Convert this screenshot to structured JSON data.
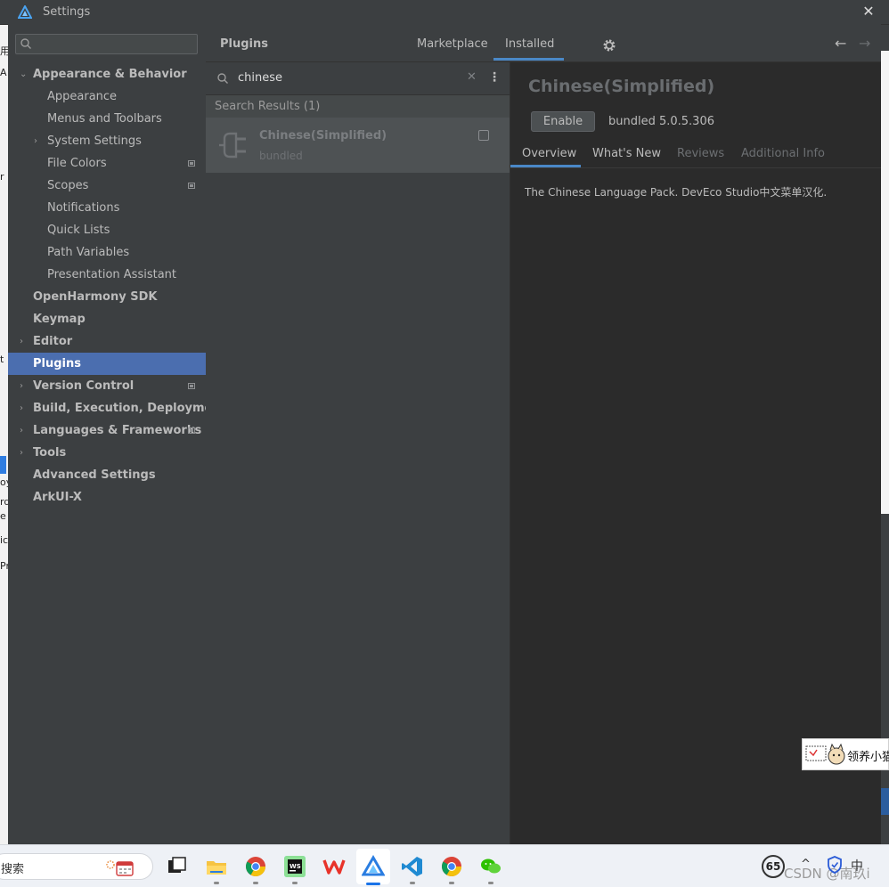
{
  "window": {
    "title": "Settings"
  },
  "sidebar": {
    "items": [
      {
        "label": "Appearance & Behavior",
        "arrow": "⌄"
      },
      {
        "label": "Appearance"
      },
      {
        "label": "Menus and Toolbars"
      },
      {
        "label": "System Settings",
        "arrow": "›"
      },
      {
        "label": "File Colors"
      },
      {
        "label": "Scopes"
      },
      {
        "label": "Notifications"
      },
      {
        "label": "Quick Lists"
      },
      {
        "label": "Path Variables"
      },
      {
        "label": "Presentation Assistant"
      },
      {
        "label": "OpenHarmony SDK"
      },
      {
        "label": "Keymap"
      },
      {
        "label": "Editor",
        "arrow": "›"
      },
      {
        "label": "Plugins"
      },
      {
        "label": "Version Control",
        "arrow": "›"
      },
      {
        "label": "Build, Execution, Deployment",
        "arrow": "›"
      },
      {
        "label": "Languages & Frameworks",
        "arrow": "›"
      },
      {
        "label": "Tools",
        "arrow": "›"
      },
      {
        "label": "Advanced Settings"
      },
      {
        "label": "ArkUI-X"
      }
    ]
  },
  "header": {
    "title": "Plugins",
    "tabs": [
      "Marketplace",
      "Installed"
    ],
    "nav": {
      "back": "←",
      "forward": "→"
    }
  },
  "plugin_list": {
    "search_value": "chinese",
    "clear_glyph": "✕",
    "more_glyph": "⋮",
    "results_label": "Search Results (1)",
    "items": [
      {
        "name": "Chinese(Simplified)",
        "status": "bundled"
      }
    ]
  },
  "detail": {
    "name": "Chinese(Simplified)",
    "enable_label": "Enable",
    "version": "bundled 5.0.5.306",
    "tabs": [
      "Overview",
      "What's New",
      "Reviews",
      "Additional Info"
    ],
    "description": "The Chinese Language Pack. DevEco Studio中文菜单汉化."
  },
  "background": {
    "left_glyphs": [
      "用",
      "A",
      "r",
      "t",
      "oy",
      "rd",
      "e",
      "ic",
      "Pr"
    ]
  },
  "popup": {
    "text": "领养小猫"
  },
  "taskbar": {
    "search_text": "搜索",
    "apps": [
      "windows-terminal",
      "file-explorer",
      "chrome",
      "webstorm",
      "wps",
      "deveco-studio",
      "vscode",
      "chrome",
      "wechat"
    ],
    "tray_badge": "65",
    "tray_chevron": "^",
    "ime": "中",
    "watermark": "CSDN @南玖i"
  },
  "colors": {
    "accent": "#4a88c7",
    "selection": "#4b6eaf",
    "panel": "#3c3f41",
    "content": "#2b2b2b"
  }
}
